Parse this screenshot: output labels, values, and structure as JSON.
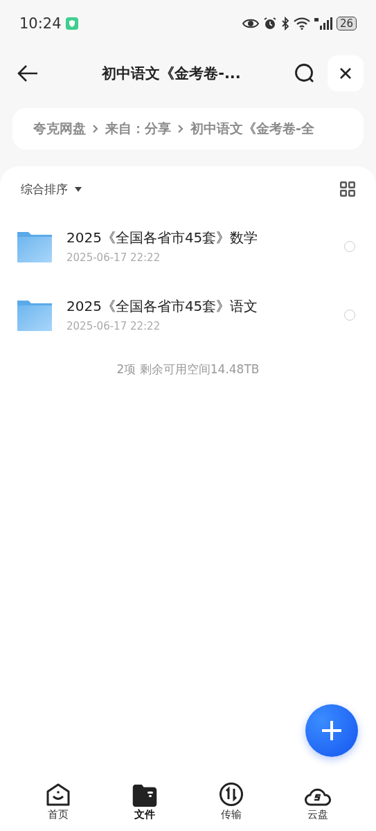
{
  "status_bar": {
    "time": "10:24",
    "battery": "26"
  },
  "header": {
    "title": "初中语文《金考卷-..."
  },
  "breadcrumb": [
    "夸克网盘",
    "来自：分享",
    "初中语文《金考卷-全"
  ],
  "toolbar": {
    "sort_label": "综合排序"
  },
  "files": [
    {
      "name": "2025《全国各省市45套》数学",
      "date": "2025-06-17 22:22",
      "selected": false
    },
    {
      "name": "2025《全国各省市45套》语文",
      "date": "2025-06-17 22:22",
      "selected": false
    }
  ],
  "summary": "2项 剩余可用空间14.48TB",
  "bottom_nav": [
    {
      "kind": "home",
      "label": "首页",
      "selected": false
    },
    {
      "kind": "files",
      "label": "文件",
      "selected": true
    },
    {
      "kind": "transfer",
      "label": "传输",
      "selected": false
    },
    {
      "kind": "cloud",
      "label": "云盘",
      "selected": false
    }
  ]
}
